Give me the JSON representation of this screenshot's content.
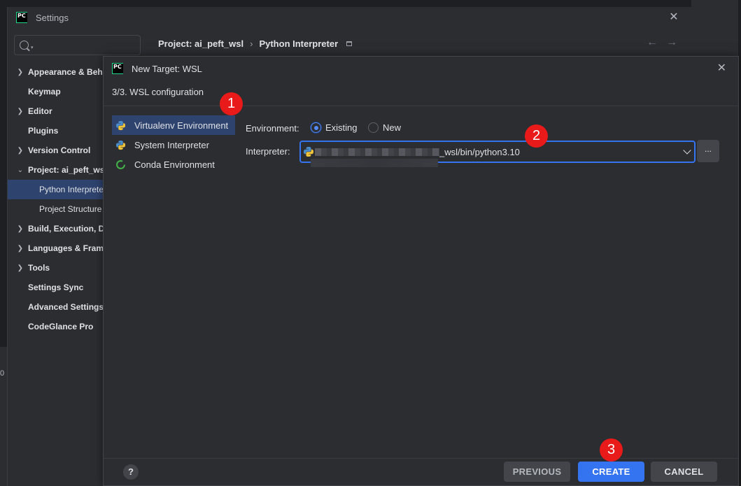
{
  "settings": {
    "title": "Settings",
    "search": {
      "placeholder": ""
    },
    "breadcrumb": {
      "project": "Project: ai_peft_wsl",
      "separator": "›",
      "page": "Python Interpreter"
    },
    "nav": {
      "back": "←",
      "forward": "→"
    },
    "sidebar": {
      "items": [
        {
          "label": "Appearance & Behavior",
          "expandable": true
        },
        {
          "label": "Keymap",
          "expandable": false
        },
        {
          "label": "Editor",
          "expandable": true
        },
        {
          "label": "Plugins",
          "expandable": false
        },
        {
          "label": "Version Control",
          "expandable": true
        },
        {
          "label": "Project: ai_peft_wsl",
          "expandable": true,
          "expanded": true
        },
        {
          "label": "Python Interpreter",
          "sub": true,
          "selected": true
        },
        {
          "label": "Project Structure",
          "sub": true
        },
        {
          "label": "Build, Execution, Deployment",
          "expandable": true
        },
        {
          "label": "Languages & Frameworks",
          "expandable": true
        },
        {
          "label": "Tools",
          "expandable": true
        },
        {
          "label": "Settings Sync",
          "expandable": false
        },
        {
          "label": "Advanced Settings",
          "expandable": false
        },
        {
          "label": "CodeGlance Pro",
          "expandable": false
        }
      ]
    }
  },
  "dialog": {
    "title": "New Target: WSL",
    "step": "3/3. WSL configuration",
    "types": [
      {
        "label": "Virtualenv Environment",
        "icon": "python-icon",
        "selected": true
      },
      {
        "label": "System Interpreter",
        "icon": "python-icon"
      },
      {
        "label": "Conda Environment",
        "icon": "conda-icon"
      }
    ],
    "environment": {
      "label": "Environment:",
      "options": [
        {
          "label": "Existing",
          "checked": true
        },
        {
          "label": "New",
          "checked": false
        }
      ]
    },
    "interpreter": {
      "label": "Interpreter:",
      "value": "_wsl/bin/python3.10"
    },
    "browse_label": "...",
    "buttons": {
      "previous": "PREVIOUS",
      "create": "CREATE",
      "cancel": "CANCEL",
      "help": "?"
    }
  },
  "annotations": [
    {
      "number": "1"
    },
    {
      "number": "2"
    },
    {
      "number": "3"
    }
  ],
  "colors": {
    "accent": "#3574f0",
    "selection": "#2e436e",
    "annotation": "#e81a1a",
    "background": "#2b2d30"
  }
}
